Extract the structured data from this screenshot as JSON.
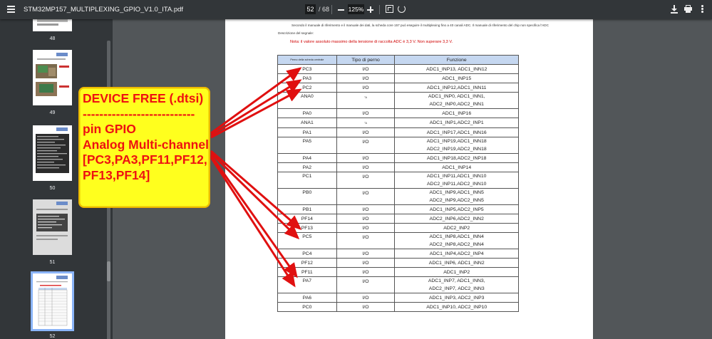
{
  "toolbar": {
    "file_title": "STM32MP157_MULTIPLEXING_GPIO_V1.0_ITA.pdf",
    "page_current": "52",
    "page_separator": "/",
    "page_total": "68",
    "zoom": "125%"
  },
  "sidebar": {
    "thumbnails": [
      {
        "label": "48"
      },
      {
        "label": "49"
      },
      {
        "label": "50"
      },
      {
        "label": "51"
      },
      {
        "label": "52"
      }
    ]
  },
  "document": {
    "intro_line": "Secondo il manuale di riferimento e il manuale dei dati, la scheda core 157 può eseguire il multiplexing fino a 40 canali ADC. Il manuale di riferimento del chip non specifica l'ADC",
    "signal_desc": "Descrizione del segnale:",
    "note": "Nota: il valore assoluto massimo della tensione di raccolta ADC è 3,3 V. Non superare 3,3 V.",
    "table": {
      "headers": [
        "Perno della scheda centrale",
        "Tipo di perno",
        "Funzione"
      ],
      "rows": [
        {
          "pin": "PC3",
          "type": "I/O",
          "fn": [
            "ADC1_INP13, ADC1_INN12"
          ]
        },
        {
          "pin": "PA3",
          "type": "I/O",
          "fn": [
            "ADC1_INP15"
          ]
        },
        {
          "pin": "PC2",
          "type": "I/O",
          "fn": [
            "ADC1_INP12,ADC1_INN11"
          ]
        },
        {
          "pin": "ANA0",
          "type": "°A",
          "tiny": true,
          "fn": [
            "ADC1_INP0, ADC1_INN1,",
            "ADC2_INP0,ADC2_INN1"
          ]
        },
        {
          "pin": "PA0",
          "type": "I/O",
          "fn": [
            "ADC1_INP16"
          ]
        },
        {
          "pin": "ANA1",
          "type": "°A",
          "tiny": true,
          "fn": [
            "ADC1_INP1,ADC2_INP1"
          ]
        },
        {
          "pin": "PA1",
          "type": "I/O",
          "fn": [
            "ADC1_INP17,ADC1_INN16"
          ]
        },
        {
          "pin": "PA5",
          "type": "I/O",
          "fn": [
            "ADC1_INP19,ADC1_INN18",
            "ADC2_INP19,ADC2_INN18"
          ]
        },
        {
          "pin": "PA4",
          "type": "I/O",
          "fn": [
            "ADC1_INP18,ADC2_INP18"
          ]
        },
        {
          "pin": "PA2",
          "type": "I/O",
          "fn": [
            "ADC1_INP14"
          ]
        },
        {
          "pin": "PC1",
          "type": "I/O",
          "fn": [
            "ADC1_INP11,ADC1_INN10",
            "ADC2_INP11,ADC2_INN10"
          ]
        },
        {
          "pin": "PB0",
          "type": "I/O",
          "fn": [
            "ADC1_INP9,ADC1_INN5",
            "ADC2_INP9,ADC2_INN5"
          ]
        },
        {
          "pin": "PB1",
          "type": "I/O",
          "fn": [
            "ADC1_INP5,ADC2_INP5"
          ]
        },
        {
          "pin": "PF14",
          "type": "I/O",
          "fn": [
            "ADC2_INP6,ADC2_INN2"
          ]
        },
        {
          "pin": "PF13",
          "type": "I/O",
          "fn": [
            "ADC2_INP2"
          ]
        },
        {
          "pin": "PC5",
          "type": "I/O",
          "fn": [
            "ADC1_INP8,ADC1_INN4",
            "ADC2_INP8,ADC2_INN4"
          ]
        },
        {
          "pin": "PC4",
          "type": "I/O",
          "fn": [
            "ADC1_INP4,ADC2_INP4"
          ]
        },
        {
          "pin": "PF12",
          "type": "I/O",
          "fn": [
            "ADC1_INP6, ADC1_INN2"
          ]
        },
        {
          "pin": "PF11",
          "type": "I/O",
          "fn": [
            "ADC1_INP2"
          ]
        },
        {
          "pin": "PA7",
          "type": "I/O",
          "fn": [
            "ADC1_INP7, ADC1_INN3,",
            "ADC2_INP7, ADC2_INN3"
          ]
        },
        {
          "pin": "PA6",
          "type": "I/O",
          "fn": [
            "ADC1_INP3, ADC2_INP3"
          ]
        },
        {
          "pin": "PC0",
          "type": "I/O",
          "fn": [
            "ADC1_INP10, ADC2_INP10"
          ]
        }
      ]
    }
  },
  "annotation": {
    "lines": [
      "DEVICE FREE (.dtsi)",
      "---------------------------",
      "pin GPIO",
      "Analog Multi-channel",
      "[PC3,PA3,PF11,PF12,",
      "PF13,PF14]"
    ],
    "text_color": "#ee1111",
    "box_color": "#ffff1e",
    "arrow_color": "#e01010"
  }
}
